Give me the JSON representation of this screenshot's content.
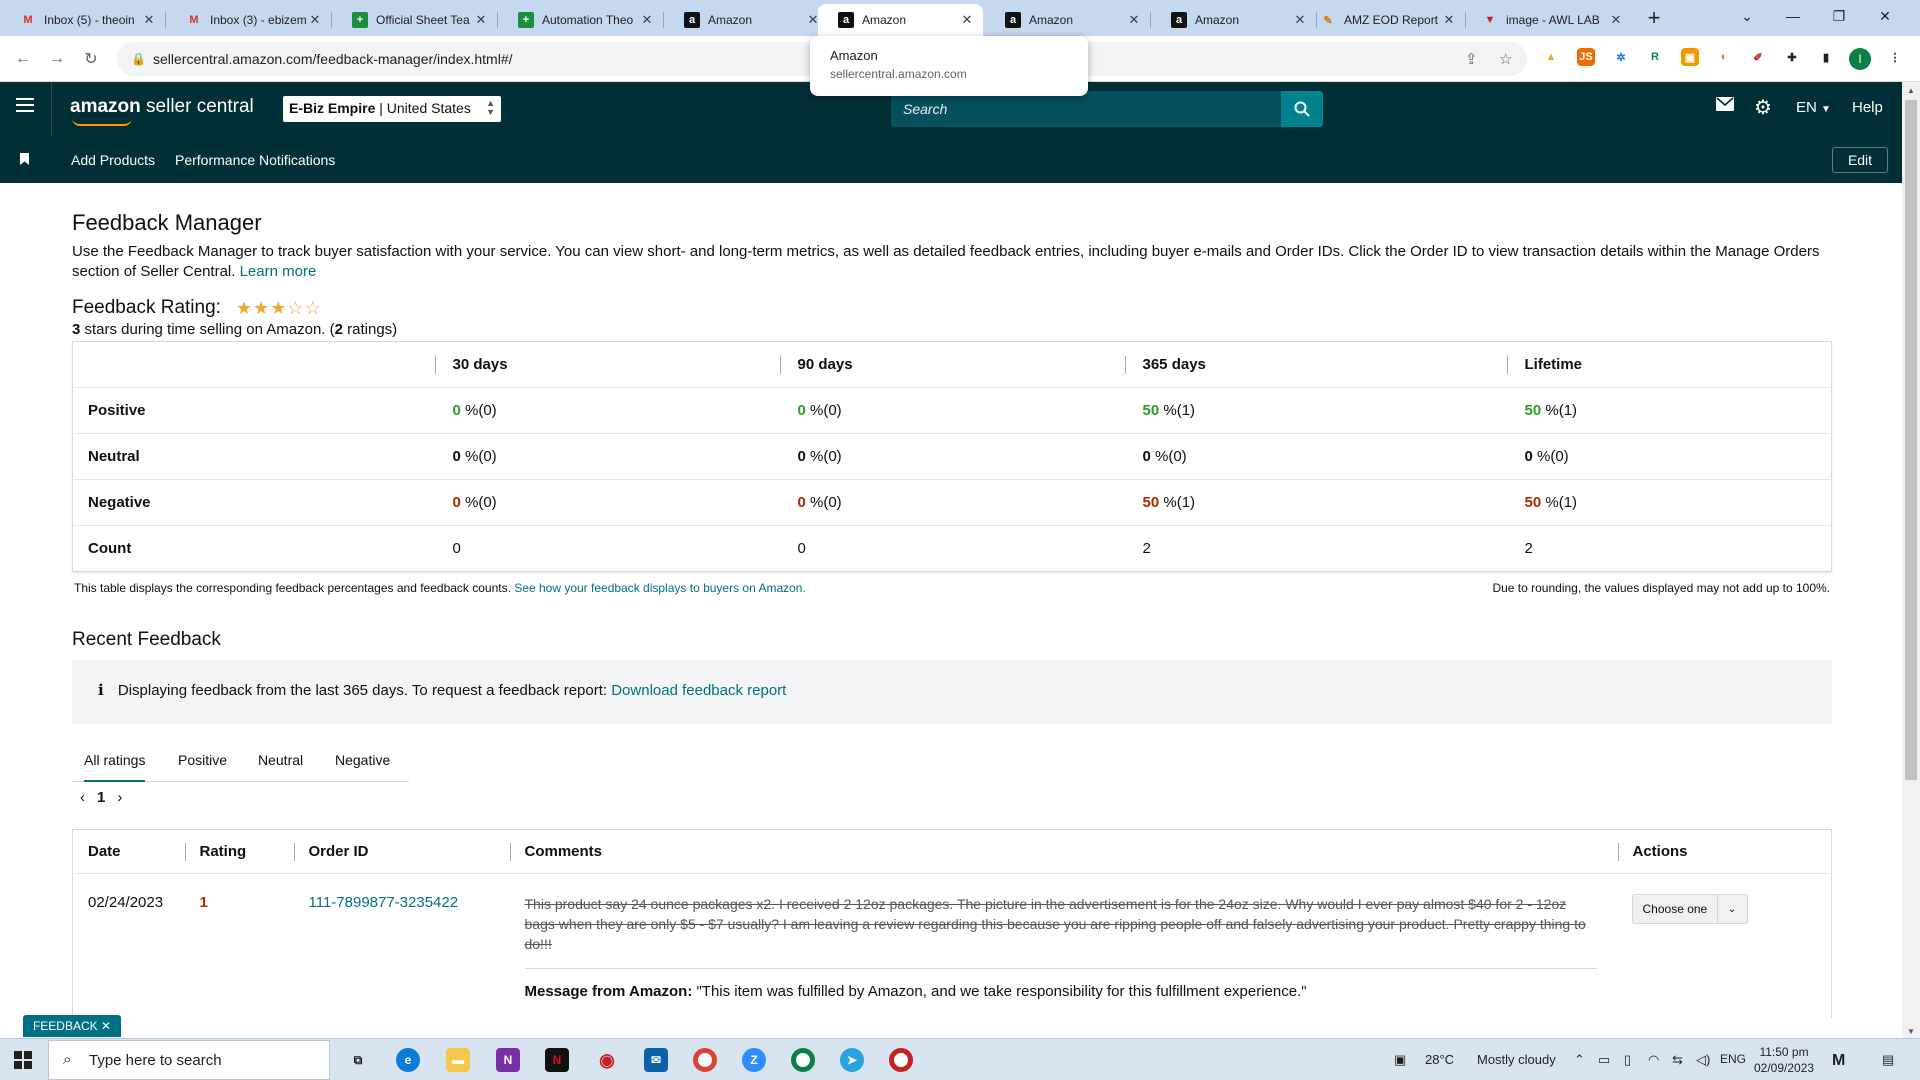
{
  "browser": {
    "tabs": [
      {
        "title": "Inbox (5) - theoin",
        "icon": "gmail-icon"
      },
      {
        "title": "Inbox (3) - ebizem",
        "icon": "gmail-icon"
      },
      {
        "title": "Official Sheet Tea",
        "icon": "sheets-icon"
      },
      {
        "title": "Automation Theo",
        "icon": "sheets-icon"
      },
      {
        "title": "Amazon",
        "icon": "amazon-icon"
      },
      {
        "title": "Amazon",
        "icon": "amazon-icon"
      },
      {
        "title": "Amazon",
        "icon": "amazon-icon"
      },
      {
        "title": "Amazon",
        "icon": "amazon-icon"
      },
      {
        "title": "AMZ EOD Report",
        "icon": "pen-icon"
      },
      {
        "title": "image - AWL LAB",
        "icon": "lab-icon"
      }
    ],
    "active_tab_index": 5,
    "url": "sellercentral.amazon.com/feedback-manager/index.html#/",
    "tooltip": {
      "title": "Amazon",
      "domain": "sellercentral.amazon.com"
    },
    "profile_initial": "I"
  },
  "header": {
    "logo_bold": "amazon",
    "logo_rest": " seller central",
    "store_name": "E-Biz Empire",
    "store_region": " | United States",
    "search_placeholder": "Search",
    "language": "EN",
    "help": "Help"
  },
  "subnav": {
    "links": [
      "Add Products",
      "Performance Notifications"
    ],
    "edit": "Edit"
  },
  "page": {
    "title": "Feedback Manager",
    "intro": "Use the Feedback Manager to track buyer satisfaction with your service. You can view short- and long-term metrics, as well as detailed feedback entries, including buyer e-mails and Order IDs. Click the Order ID to view transaction details within the Manage Orders section of Seller Central.",
    "learn_more": "Learn more",
    "rating_label": "Feedback Rating:",
    "rating_stars": 3,
    "rating_max": 5,
    "rating_sub_stars": "3",
    "rating_sub_mid": " stars during time selling on Amazon. (",
    "rating_sub_count": "2",
    "rating_sub_end": " ratings)"
  },
  "metrics": {
    "columns": [
      "30 days",
      "90 days",
      "365 days",
      "Lifetime"
    ],
    "rows": [
      {
        "label": "Positive",
        "cells": [
          {
            "pct": "0",
            "rest": " %(0)"
          },
          {
            "pct": "0",
            "rest": " %(0)"
          },
          {
            "pct": "50",
            "rest": " %(1)"
          },
          {
            "pct": "50",
            "rest": " %(1)"
          }
        ]
      },
      {
        "label": "Neutral",
        "cells": [
          {
            "pct": "0",
            "rest": " %(0)"
          },
          {
            "pct": "0",
            "rest": " %(0)"
          },
          {
            "pct": "0",
            "rest": " %(0)"
          },
          {
            "pct": "0",
            "rest": " %(0)"
          }
        ]
      },
      {
        "label": "Negative",
        "cells": [
          {
            "pct": "0",
            "rest": " %(0)"
          },
          {
            "pct": "0",
            "rest": " %(0)"
          },
          {
            "pct": "50",
            "rest": " %(1)"
          },
          {
            "pct": "50",
            "rest": " %(1)"
          }
        ]
      },
      {
        "label": "Count",
        "cells": [
          {
            "pct": "",
            "rest": "0"
          },
          {
            "pct": "",
            "rest": "0"
          },
          {
            "pct": "",
            "rest": "2"
          },
          {
            "pct": "",
            "rest": "2"
          }
        ]
      }
    ],
    "note_left": "This table displays the corresponding feedback percentages and feedback counts.",
    "note_left_link": "See how your feedback displays to buyers on Amazon.",
    "note_right": "Due to rounding, the values displayed may not add up to 100%."
  },
  "recent": {
    "title": "Recent Feedback",
    "info_icon": "i",
    "info_text": "Displaying feedback from the last 365 days. To request a feedback report:",
    "info_link": "Download feedback report",
    "tabs": [
      "All ratings",
      "Positive",
      "Neutral",
      "Negative"
    ],
    "selected_tab": 0,
    "page": "1",
    "columns": [
      "Date",
      "Rating",
      "Order ID",
      "Comments",
      "Actions"
    ],
    "rows": [
      {
        "date": "02/24/2023",
        "rating": "1",
        "order_id": "111-7899877-3235422",
        "comment": "This product say 24 ounce packages x2. I received 2 12oz packages. The picture in the advertisement is for the 24oz size. Why would I ever pay almost $40 for 2 - 12oz bags when they are only $5 - $7 usually? I am leaving a review regarding this because you are ripping people off and falsely advertising your product. Pretty crappy thing to do!!!",
        "message_label": "Message from Amazon:",
        "message": " \"This item was fulfilled by Amazon, and we take responsibility for this fulfillment experience.\"",
        "action": "Choose one"
      }
    ]
  },
  "feedback_button": "FEEDBACK",
  "taskbar": {
    "search_placeholder": "Type here to search",
    "temperature": "28°C",
    "weather": "Mostly cloudy",
    "language": "ENG",
    "time": "11:50 pm",
    "date": "02/09/2023"
  },
  "colors": {
    "brand_dark": "#002f36",
    "link": "#007185",
    "positive": "#2e9b2b",
    "negative": "#b12704",
    "star": "#f2a72f"
  }
}
